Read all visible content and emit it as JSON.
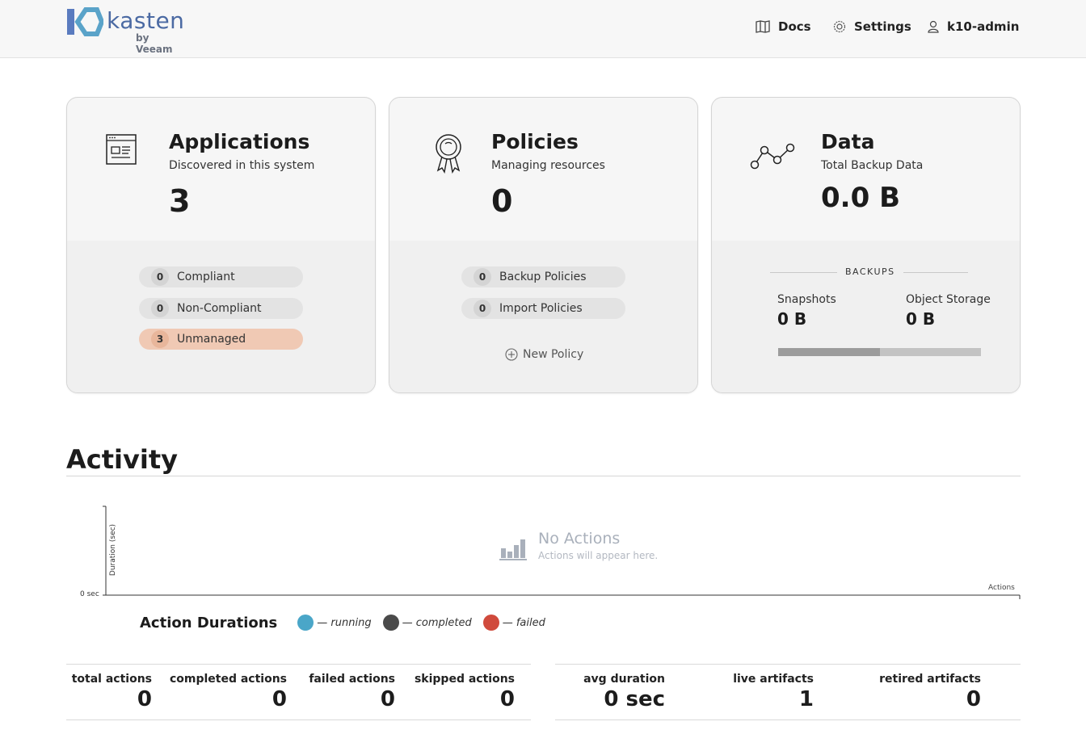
{
  "header": {
    "brand_name": "kasten",
    "brand_sub": "by Veeam",
    "nav": {
      "docs": "Docs",
      "settings": "Settings",
      "user": "k10-admin"
    }
  },
  "cards": {
    "applications": {
      "title": "Applications",
      "subtitle": "Discovered in this system",
      "count": "3",
      "pills": [
        {
          "count": "0",
          "label": "Compliant"
        },
        {
          "count": "0",
          "label": "Non-Compliant"
        },
        {
          "count": "3",
          "label": "Unmanaged"
        }
      ]
    },
    "policies": {
      "title": "Policies",
      "subtitle": "Managing resources",
      "count": "0",
      "pills": [
        {
          "count": "0",
          "label": "Backup Policies"
        },
        {
          "count": "0",
          "label": "Import Policies"
        }
      ],
      "new_policy": "New Policy"
    },
    "data": {
      "title": "Data",
      "subtitle": "Total Backup Data",
      "count": "0.0 B",
      "backups_label": "BACKUPS",
      "snapshots_label": "Snapshots",
      "snapshots_value": "0 B",
      "object_storage_label": "Object Storage",
      "object_storage_value": "0 B",
      "split_fraction": 0.5
    }
  },
  "activity": {
    "title": "Activity",
    "chart": {
      "y_label": "Duration (sec)",
      "y_zero": "0 sec",
      "x_label": "Actions",
      "empty_title": "No Actions",
      "empty_sub": "Actions will appear here."
    },
    "legend": {
      "title": "Action Durations",
      "items": [
        {
          "label": "— running",
          "color": "#4aa6c8"
        },
        {
          "label": "— completed",
          "color": "#4a4a4a"
        },
        {
          "label": "— failed",
          "color": "#d04a3c"
        }
      ]
    },
    "stats_left": [
      {
        "label": "total actions",
        "value": "0"
      },
      {
        "label": "completed actions",
        "value": "0"
      },
      {
        "label": "failed actions",
        "value": "0"
      },
      {
        "label": "skipped actions",
        "value": "0"
      }
    ],
    "stats_right": [
      {
        "label": "avg duration",
        "value": "0 sec"
      },
      {
        "label": "live artifacts",
        "value": "1"
      },
      {
        "label": "retired artifacts",
        "value": "0"
      }
    ]
  },
  "colors": {
    "brand": "#4b6aa3",
    "unmanaged_pill": "#f0c9b4"
  }
}
